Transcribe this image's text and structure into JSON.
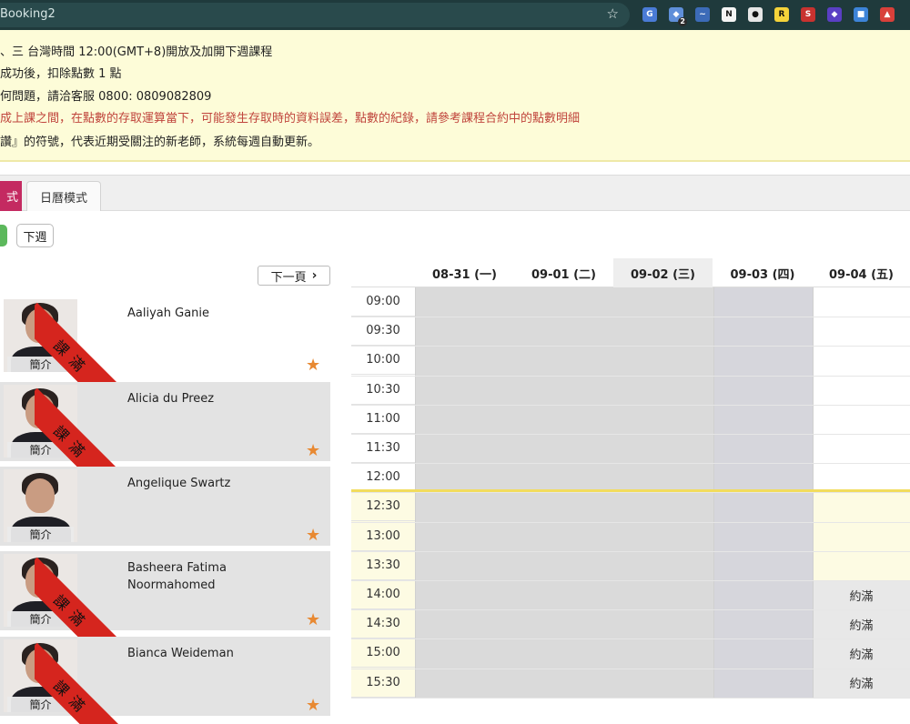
{
  "browser": {
    "tab_title": "Booking2",
    "extensions": [
      {
        "icon": "translate-icon",
        "color": "#4a7bd6",
        "glyph": "G"
      },
      {
        "icon": "puzzle-icon",
        "color": "#5f8fd9",
        "glyph": "◆",
        "badge": "2"
      },
      {
        "icon": "wave-icon",
        "color": "#3c6bb8",
        "glyph": "~"
      },
      {
        "icon": "notion-icon",
        "color": "#f4f4f4",
        "glyph": "N"
      },
      {
        "icon": "circle-icon",
        "color": "#e6e6e6",
        "glyph": "●"
      },
      {
        "icon": "r-icon",
        "color": "#f5d33a",
        "glyph": "R"
      },
      {
        "icon": "bug-icon",
        "color": "#c8322f",
        "glyph": "S"
      },
      {
        "icon": "diamond-icon",
        "color": "#5a3fc4",
        "glyph": "◆"
      },
      {
        "icon": "cube-icon",
        "color": "#3d84d8",
        "glyph": "■"
      },
      {
        "icon": "game-icon",
        "color": "#d8403a",
        "glyph": "▲"
      }
    ]
  },
  "notice": {
    "lines": [
      {
        "text": "、三 台灣時間 12:00(GMT+8)開放及加開下週課程",
        "red": false
      },
      {
        "text": "成功後，扣除點數 1 點",
        "red": false
      },
      {
        "text": "何問題，請洽客服 0800: 0809082809",
        "red": false
      },
      {
        "text": "成上課之間，在點數的存取運算當下，可能發生存取時的資料誤差，點數的紀錄，請參考課程合約中的點數明細",
        "red": true
      },
      {
        "text": "讚』的符號，代表近期受關注的新老師，系統每週自動更新。",
        "red": false
      }
    ]
  },
  "tabs": {
    "active_label": "式",
    "calendar_label": "日曆模式"
  },
  "week_nav": {
    "next_week_label": "下週"
  },
  "teacher_list": {
    "next_page_label": "下一頁",
    "intro_label": "簡介",
    "ribbon_text": "課滿",
    "teachers": [
      {
        "name": "Aaliyah Ganie",
        "full": true
      },
      {
        "name": "Alicia du Preez",
        "full": true
      },
      {
        "name": "Angelique Swartz",
        "full": false
      },
      {
        "name": "Basheera Fatima Noormahomed",
        "full": true
      },
      {
        "name": "Bianca Weideman",
        "full": true
      }
    ]
  },
  "schedule": {
    "days": [
      "08-31 (一)",
      "09-01 (二)",
      "09-02 (三)",
      "09-03 (四)",
      "09-04 (五)"
    ],
    "times": [
      "09:00",
      "09:30",
      "10:00",
      "10:30",
      "11:00",
      "11:30",
      "12:00",
      "12:30",
      "13:00",
      "13:30",
      "14:00",
      "14:30",
      "15:00",
      "15:30"
    ],
    "slot_label": "約滿",
    "full_slots": [
      "14:00",
      "14:30",
      "15:00",
      "15:30"
    ]
  }
}
